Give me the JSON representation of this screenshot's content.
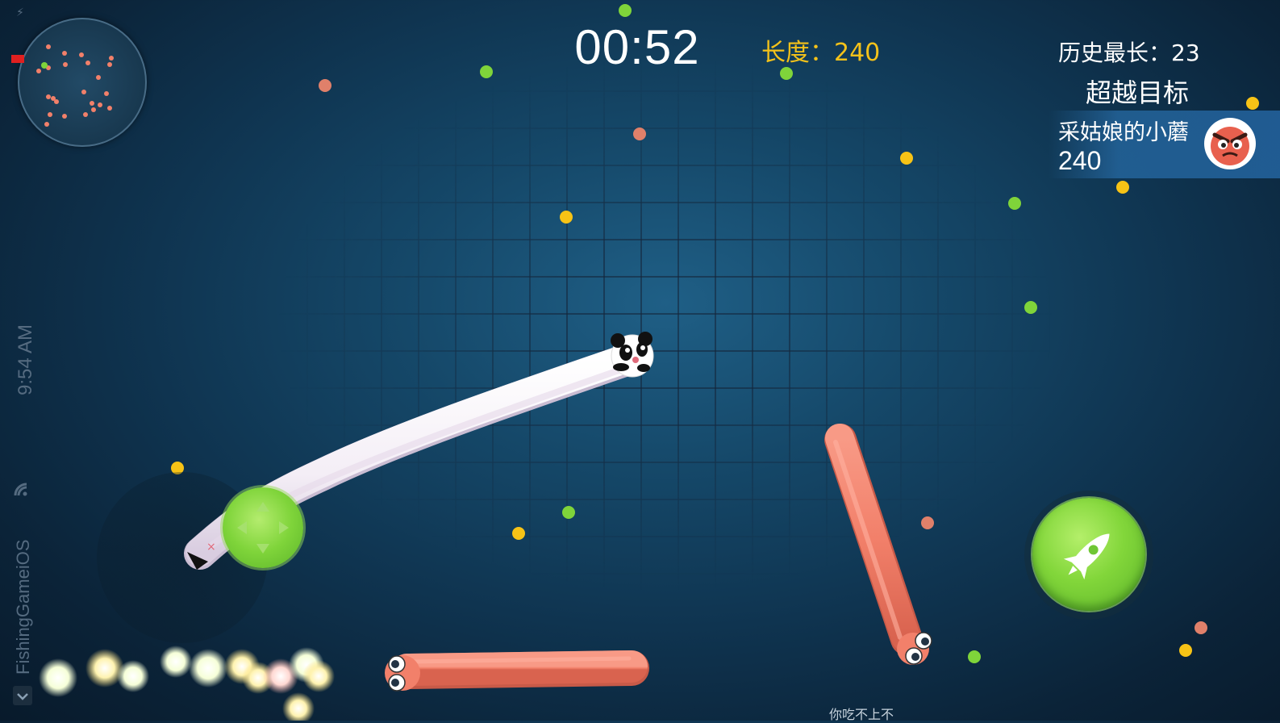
{
  "hud": {
    "timer": "00:52",
    "length_label": "长度：240",
    "best_label": "历史最长：23"
  },
  "target": {
    "title": "超越目标",
    "name": "采姑娘的小蘑",
    "length": "240",
    "avatar_icon": "angry-red-face-icon"
  },
  "status_bar": {
    "time": "9:54 AM",
    "app_name": "FishingGameiOS",
    "back_icon": "chevron-back-icon",
    "wifi_icon": "wifi-icon",
    "battery_icon": "battery-low-icon"
  },
  "controls": {
    "joystick_icon": "dpad-joystick-icon",
    "boost_icon": "rocket-icon"
  },
  "bottom_hint": "你吃不上不",
  "colors": {
    "food_green": "#7fd43a",
    "food_yellow": "#f7c316",
    "food_salmon": "#e0806a",
    "length_text": "#f4c21a",
    "enemy_snake": "#f2806a",
    "player_snake": "#ffffff",
    "boost_green": "#82d63a"
  }
}
